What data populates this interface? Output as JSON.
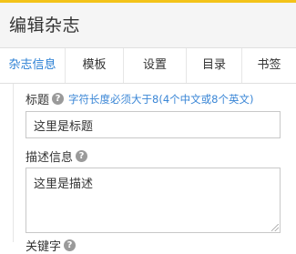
{
  "header": {
    "title": "编辑杂志"
  },
  "tabs": [
    {
      "label": "杂志信息",
      "active": true
    },
    {
      "label": "模板"
    },
    {
      "label": "设置"
    },
    {
      "label": "目录"
    },
    {
      "label": "书签"
    }
  ],
  "form": {
    "title_label": "标题",
    "title_hint": "字符长度必须大于8(4个中文或8个英文)",
    "title_value": "这里是标题",
    "desc_label": "描述信息",
    "desc_value": "这里是描述",
    "keyword_label": "关键字"
  },
  "colors": {
    "accent": "#f3c319",
    "active_tab": "#2a7fd4",
    "hint": "#3a86d6"
  }
}
